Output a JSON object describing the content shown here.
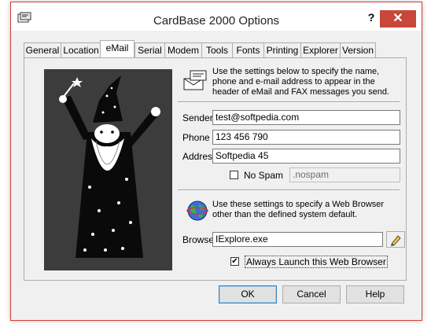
{
  "window": {
    "title": "CardBase 2000 Options",
    "help": "?",
    "close": "✕"
  },
  "tabs": [
    {
      "label": "General"
    },
    {
      "label": "Location"
    },
    {
      "label": "eMail"
    },
    {
      "label": "Serial"
    },
    {
      "label": "Modem"
    },
    {
      "label": "Tools"
    },
    {
      "label": "Fonts"
    },
    {
      "label": "Printing"
    },
    {
      "label": "Explorer"
    },
    {
      "label": "Version"
    }
  ],
  "email": {
    "description": "Use the settings below to specify the name, phone and e-mail address to appear in the header of eMail and FAX messages you send.",
    "sender_label": "Sender",
    "sender_value": "test@softpedia.com",
    "phone_label": "Phone",
    "phone_value": "123 456 790",
    "address_label": "Address",
    "address_value": "Softpedia 45",
    "nospam_label": "No Spam",
    "nospam_value": ".nospam"
  },
  "browser": {
    "description": "Use these settings to specify a Web Browser other than the defined system default.",
    "label": "Browser",
    "value": "IExplore.exe",
    "always_launch_label": "Always Launch this Web Browser",
    "always_launch_checked": true
  },
  "buttons": {
    "ok": "OK",
    "cancel": "Cancel",
    "help": "Help"
  },
  "icons": {
    "app": "cardbox-icon",
    "mail": "envelope-icon",
    "globe": "globe-icon",
    "edit": "pencil-icon",
    "wizard": "wizard-image"
  },
  "colors": {
    "close_button": "#c7473b",
    "window_border": "#d43d3d"
  }
}
